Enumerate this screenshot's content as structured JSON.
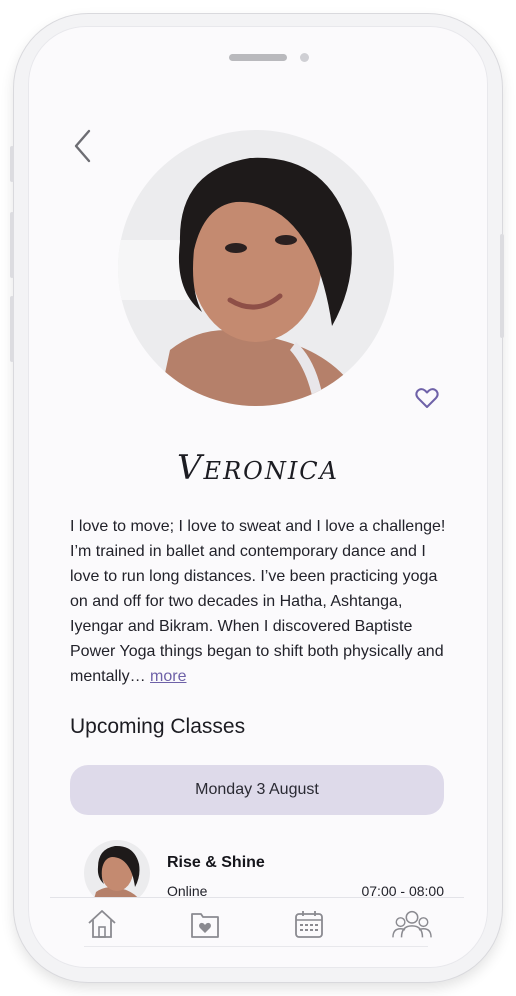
{
  "profile": {
    "name": "Veronica",
    "bio": "I love to move; I love to sweat and I love a challenge! I’m trained in ballet and contemporary dance and I love to run long distances. I’ve been practicing yoga on and off for two decades in Hatha, Ashtanga, Iyengar and Bikram. When I discovered Baptiste Power Yoga things began to shift both physically and mentally…",
    "more_link": "more"
  },
  "upcoming": {
    "title": "Upcoming Classes",
    "selected_date": "Monday 3 August",
    "classes": [
      {
        "title": "Rise & Shine",
        "mode": "Online",
        "time": "07:00 - 08:00"
      }
    ]
  },
  "icons": {
    "back": "chevron-left-icon",
    "favorite": "heart-outline-icon",
    "tabs": [
      "home-icon",
      "favorites-folder-icon",
      "calendar-icon",
      "community-icon"
    ]
  },
  "colors": {
    "accent": "#6e61a8",
    "pill": "#dedaea",
    "background": "#fbfafc"
  }
}
